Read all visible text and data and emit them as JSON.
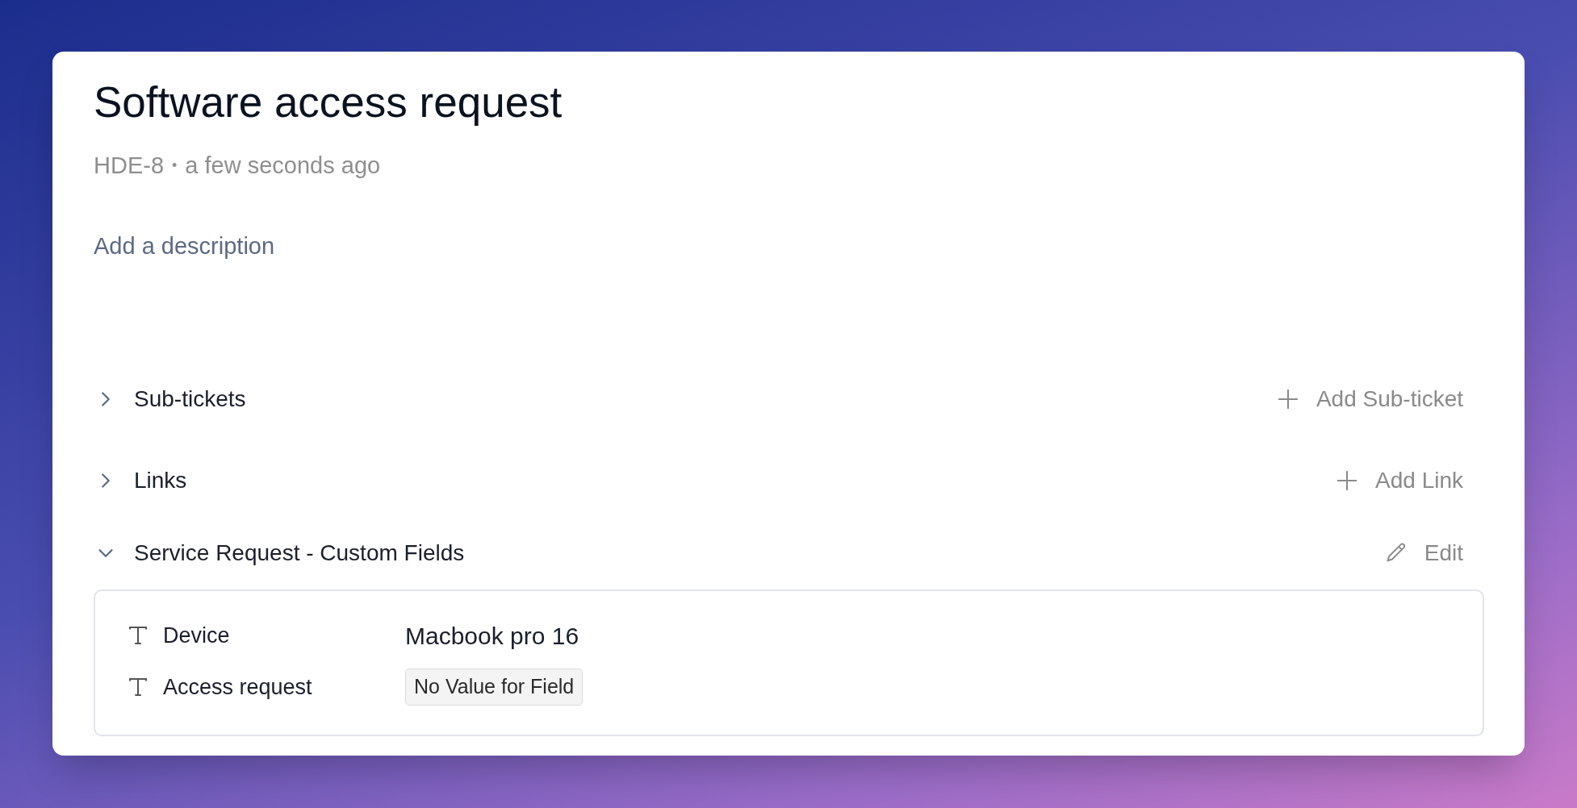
{
  "ticket": {
    "title": "Software access request",
    "key": "HDE-8",
    "separator": "•",
    "time": "a few seconds ago",
    "description_placeholder": "Add a description"
  },
  "sections": [
    {
      "title": "Sub-tickets",
      "expanded": false,
      "action": {
        "kind": "add",
        "label": "Add Sub-ticket"
      }
    },
    {
      "title": "Links",
      "expanded": false,
      "action": {
        "kind": "add",
        "label": "Add Link"
      }
    },
    {
      "title": "Service Request - Custom Fields",
      "expanded": true,
      "action": {
        "kind": "edit",
        "label": "Edit"
      },
      "fields": [
        {
          "label": "Device",
          "value": "Macbook pro 16",
          "empty": false
        },
        {
          "label": "Access request",
          "value": "No Value for Field",
          "empty": true
        }
      ]
    }
  ]
}
